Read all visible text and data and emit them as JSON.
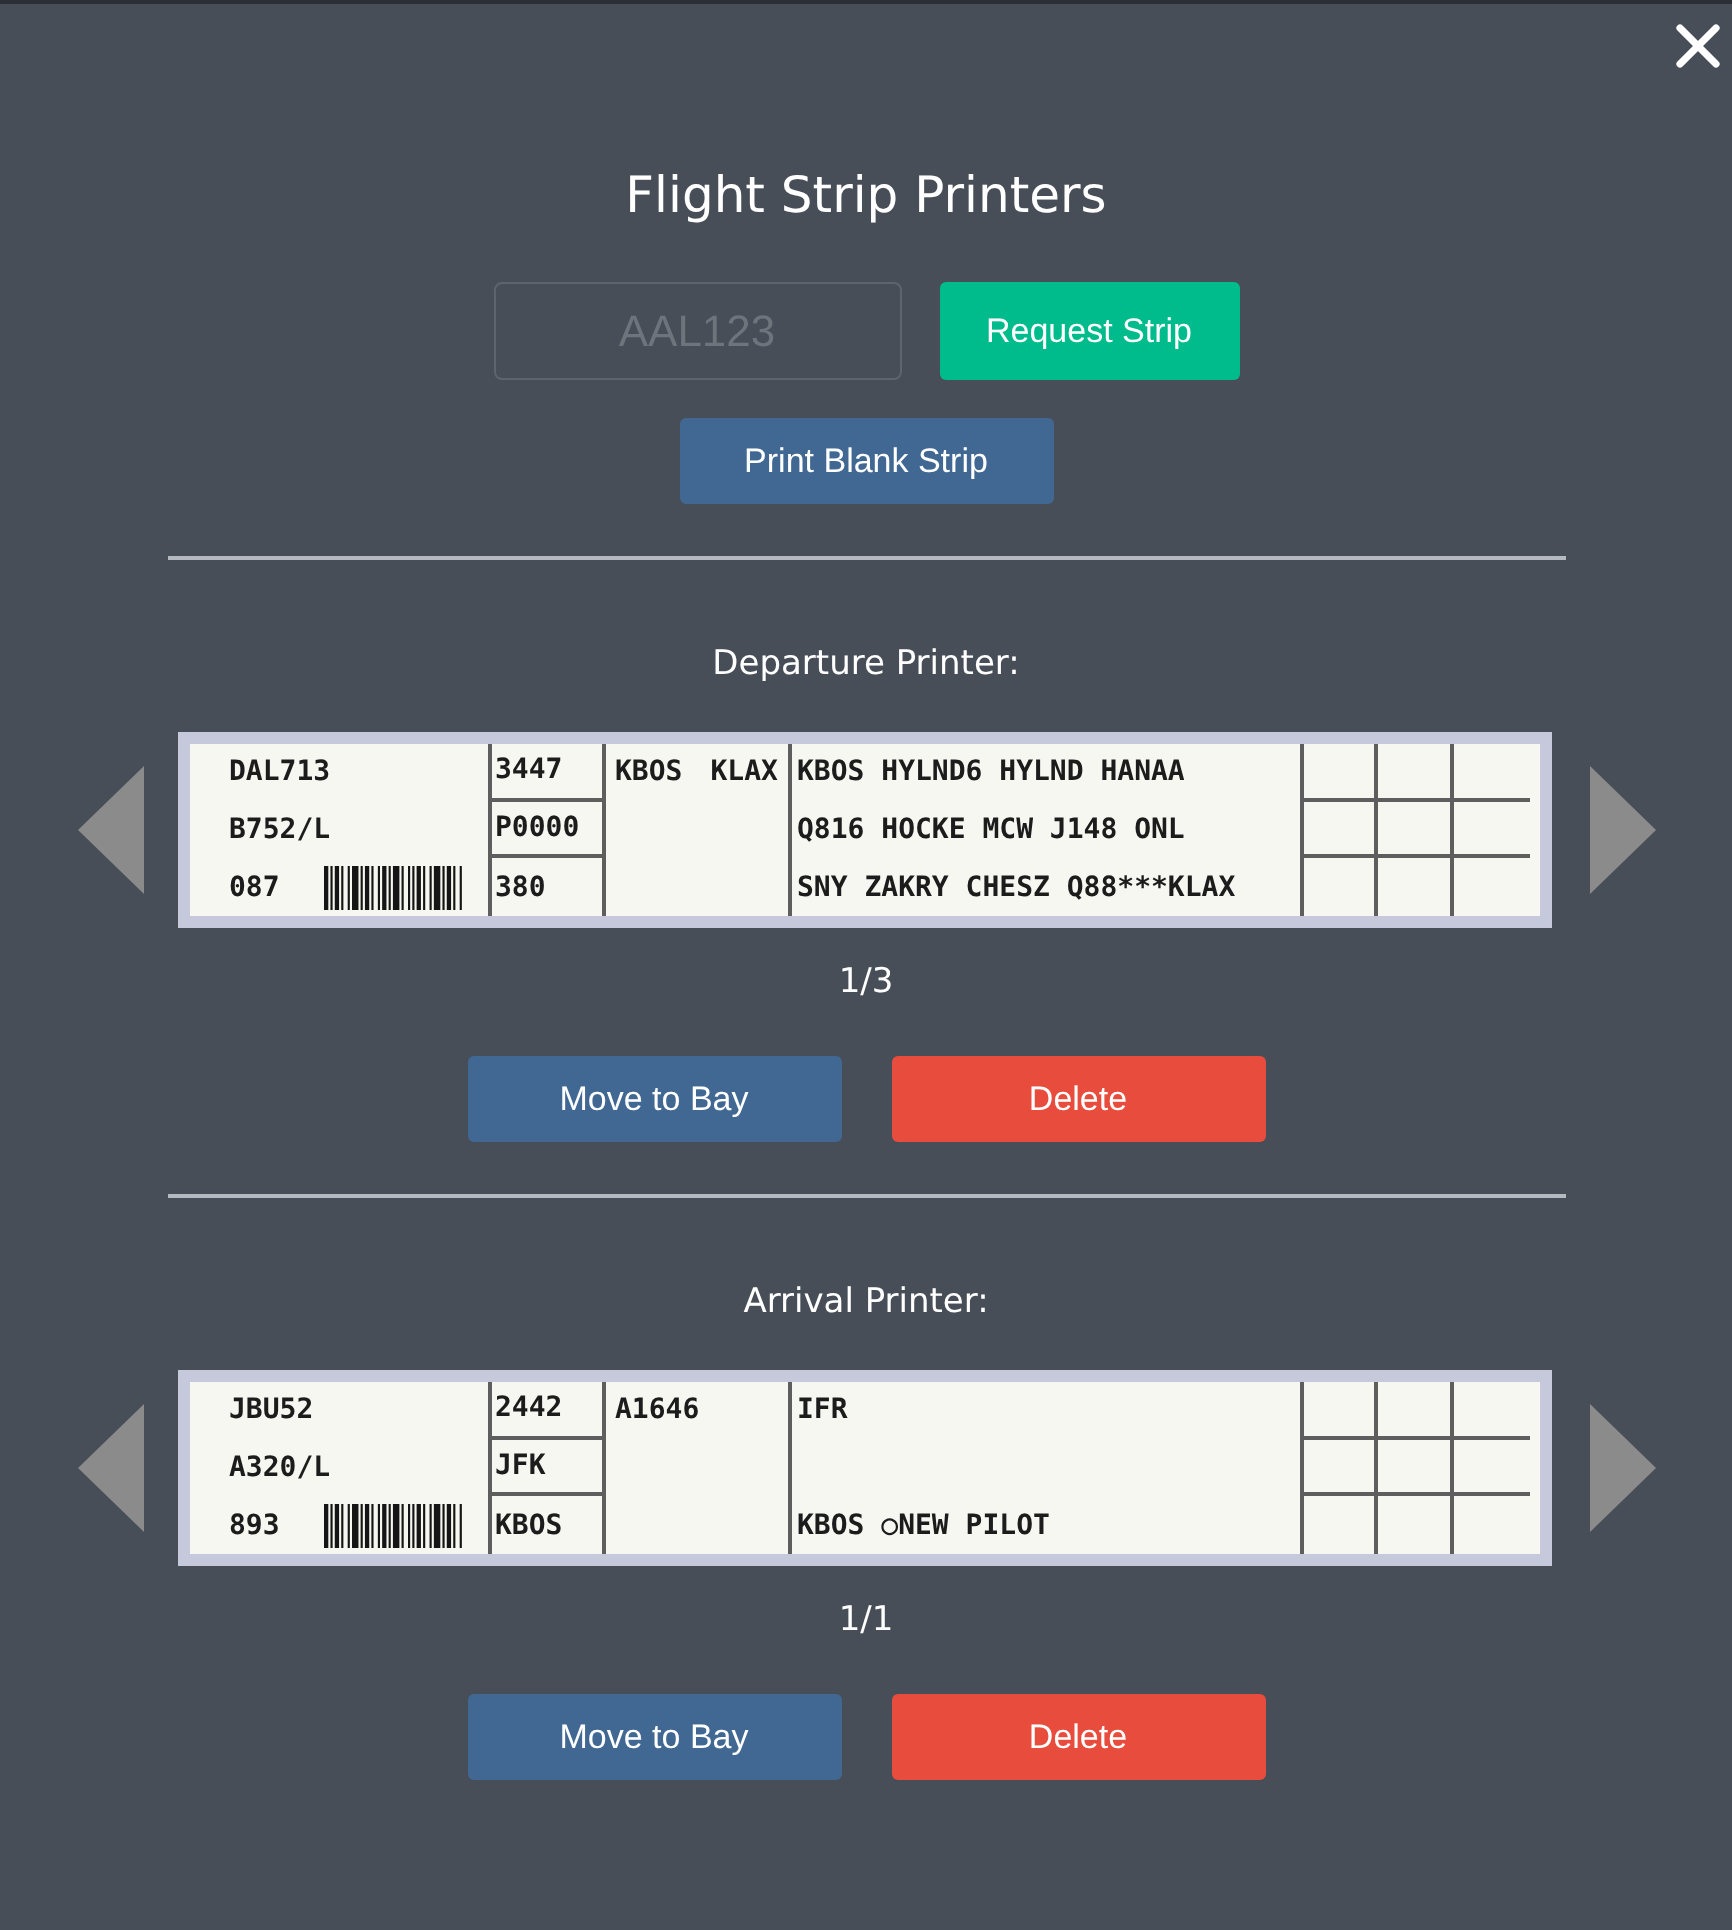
{
  "title": "Flight Strip Printers",
  "request_form": {
    "placeholder": "AAL123",
    "button": "Request Strip"
  },
  "blank_strip_button": "Print Blank Strip",
  "printers": [
    {
      "heading": "Departure Printer:",
      "strip": {
        "column_1": [
          "DAL713",
          "B752/L",
          "087"
        ],
        "column_2": [
          "3447",
          "P0000",
          "380"
        ],
        "column_3": [
          "KBOS",
          "KLAX"
        ],
        "column_4": {
          "line_1": "KBOS HYLND6 HYLND HANAA",
          "line_2": "Q816 HOCKE MCW J148 ONL",
          "line_3": "SNY ZAKRY CHESZ Q88***KLAX"
        }
      },
      "pager": "1/3",
      "buttons": [
        {
          "kind": "move",
          "label": "Move to Bay"
        },
        {
          "kind": "delete",
          "label": "Delete"
        }
      ]
    },
    {
      "heading": "Arrival Printer:",
      "strip": {
        "column_1": [
          "JBU52",
          "A320/L",
          "893"
        ],
        "column_2": [
          "2442",
          "JFK",
          "KBOS"
        ],
        "column_3": [
          "A1646"
        ],
        "column_4": {
          "line_1": "IFR",
          "line_3": "KBOS ○NEW PILOT"
        }
      },
      "pager": "1/1",
      "buttons": [
        {
          "kind": "move",
          "label": "Move to Bay"
        },
        {
          "kind": "delete",
          "label": "Delete"
        }
      ]
    }
  ]
}
